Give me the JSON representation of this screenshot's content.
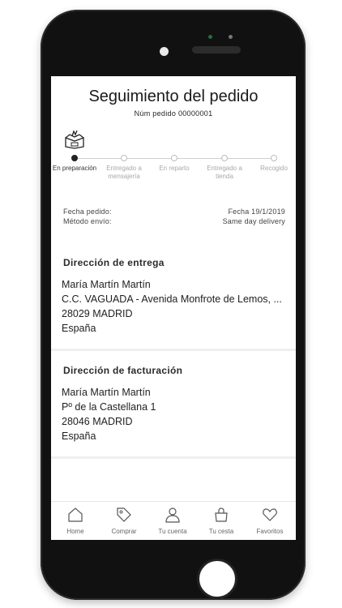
{
  "header": {
    "title": "Seguimiento del pedido",
    "order_number": "Núm pedido 00000001"
  },
  "tracking": {
    "current_step": 0,
    "steps": [
      {
        "label": "En preparación",
        "active": true
      },
      {
        "label": "Entregado a mensajería",
        "active": false
      },
      {
        "label": "En reparto",
        "active": false
      },
      {
        "label": "Entregado a tienda",
        "active": false
      },
      {
        "label": "Recogido",
        "active": false
      }
    ]
  },
  "order_info": {
    "date_label": "Fecha pedido:",
    "date_value": "Fecha 19/1/2019",
    "shipping_label": "Método envío:",
    "shipping_value": "Same day delivery"
  },
  "delivery_address": {
    "title": "Dirección de entrega",
    "lines": [
      "María Martín Martín",
      "C.C. VAGUADA - Avenida Monfrote de Lemos, ...",
      "28029 MADRID",
      "España"
    ]
  },
  "billing_address": {
    "title": "Dirección de facturación",
    "lines": [
      "María Martín Martín",
      "Pº de la Castellana 1",
      "28046 MADRID",
      "España"
    ]
  },
  "tabbar": {
    "items": [
      {
        "label": "Home",
        "icon": "home-icon"
      },
      {
        "label": "Comprar",
        "icon": "tag-icon"
      },
      {
        "label": "Tu cuenta",
        "icon": "user-icon"
      },
      {
        "label": "Tu cesta",
        "icon": "bag-icon"
      },
      {
        "label": "Favoritos",
        "icon": "heart-icon"
      }
    ]
  },
  "colors": {
    "accent": "#222222",
    "inactive": "#a8a8a8",
    "phone_body": "#111111"
  }
}
